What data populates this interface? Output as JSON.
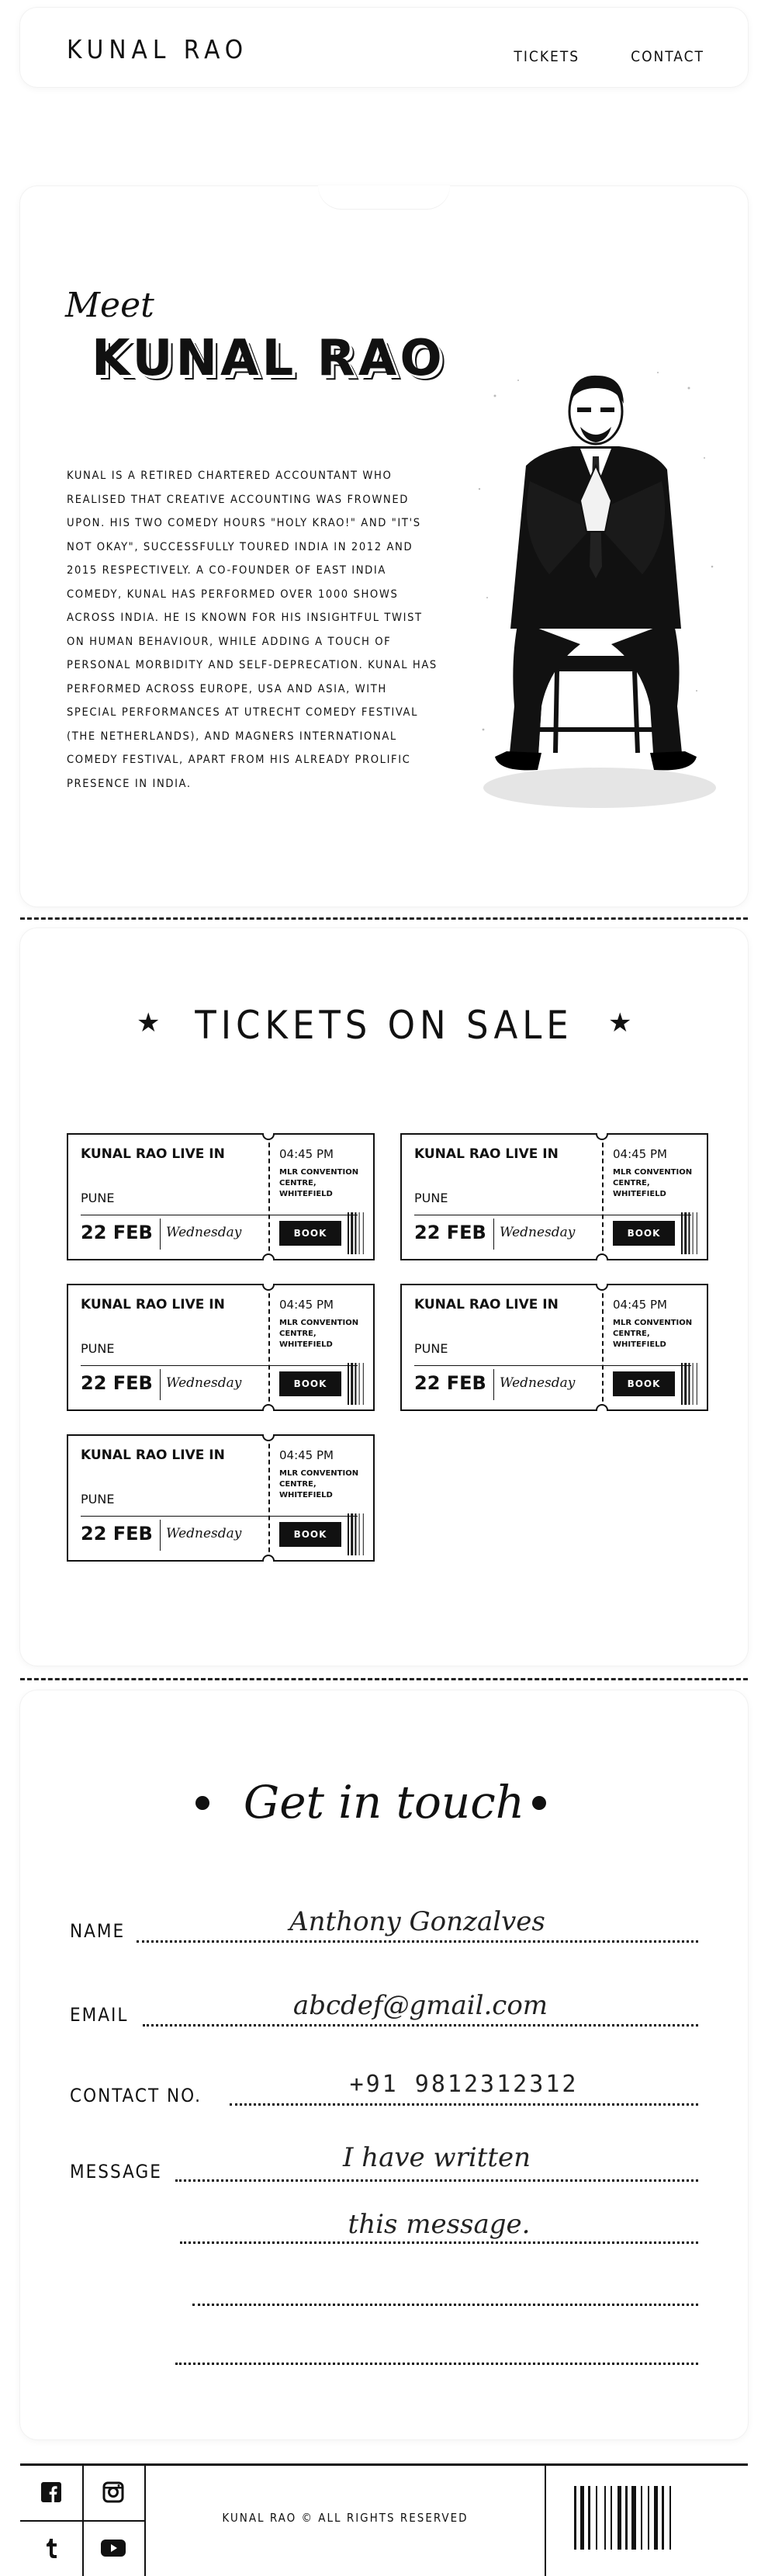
{
  "nav": {
    "logo": "KUNAL RAO",
    "links": [
      "TICKETS",
      "CONTACT"
    ]
  },
  "about": {
    "meet": "Meet",
    "name": "KUNAL RAO",
    "bio": "KUNAL IS A RETIRED CHARTERED ACCOUNTANT WHO REALISED THAT CREATIVE ACCOUNTING WAS FROWNED UPON. HIS TWO COMEDY HOURS \"HOLY KRAO!\" AND \"IT'S NOT OKAY\", SUCCESSFULLY TOURED INDIA IN 2012 AND 2015 RESPECTIVELY. A CO-FOUNDER OF EAST INDIA COMEDY, KUNAL HAS PERFORMED OVER 1000 SHOWS ACROSS INDIA. HE IS KNOWN FOR HIS INSIGHTFUL TWIST ON HUMAN BEHAVIOUR, WHILE ADDING A TOUCH OF PERSONAL MORBIDITY AND SELF-DEPRECATION. KUNAL HAS PERFORMED ACROSS EUROPE, USA AND ASIA, WITH SPECIAL PERFORMANCES AT UTRECHT COMEDY FESTIVAL (THE NETHERLANDS), AND MAGNERS INTERNATIONAL COMEDY FESTIVAL, APART FROM HIS ALREADY PROLIFIC PRESENCE IN INDIA."
  },
  "tickets": {
    "heading": "TICKETS ON SALE",
    "items": [
      {
        "title": "KUNAL RAO LIVE IN",
        "city": "PUNE",
        "date": "22 FEB",
        "day": "Wednesday",
        "time": "04:45 PM",
        "venue": "MLR CONVENTION CENTRE, WHITEFIELD",
        "button": "BOOK"
      },
      {
        "title": "KUNAL RAO LIVE IN",
        "city": "PUNE",
        "date": "22 FEB",
        "day": "Wednesday",
        "time": "04:45 PM",
        "venue": "MLR CONVENTION CENTRE, WHITEFIELD",
        "button": "BOOK"
      },
      {
        "title": "KUNAL RAO LIVE IN",
        "city": "PUNE",
        "date": "22 FEB",
        "day": "Wednesday",
        "time": "04:45 PM",
        "venue": "MLR CONVENTION CENTRE, WHITEFIELD",
        "button": "BOOK"
      },
      {
        "title": "KUNAL RAO LIVE IN",
        "city": "PUNE",
        "date": "22 FEB",
        "day": "Wednesday",
        "time": "04:45 PM",
        "venue": "MLR CONVENTION CENTRE, WHITEFIELD",
        "button": "BOOK"
      },
      {
        "title": "KUNAL RAO LIVE IN",
        "city": "PUNE",
        "date": "22 FEB",
        "day": "Wednesday",
        "time": "04:45 PM",
        "venue": "MLR CONVENTION CENTRE, WHITEFIELD",
        "button": "BOOK"
      }
    ]
  },
  "contact": {
    "heading": "Get in touch",
    "name_label": "NAME",
    "name_value": "Anthony Gonzalves",
    "email_label": "EMAIL",
    "email_value": "abcdef@gmail.com",
    "phone_label": "CONTACT NO.",
    "phone_value": "+91 9812312312",
    "message_label": "MESSAGE",
    "message_line1": "I have written",
    "message_line2": "this message."
  },
  "footer": {
    "copyright": "KUNAL RAO © ALL RIGHTS RESERVED",
    "icons": [
      "facebook-icon",
      "instagram-icon",
      "tumblr-icon",
      "youtube-icon"
    ]
  }
}
